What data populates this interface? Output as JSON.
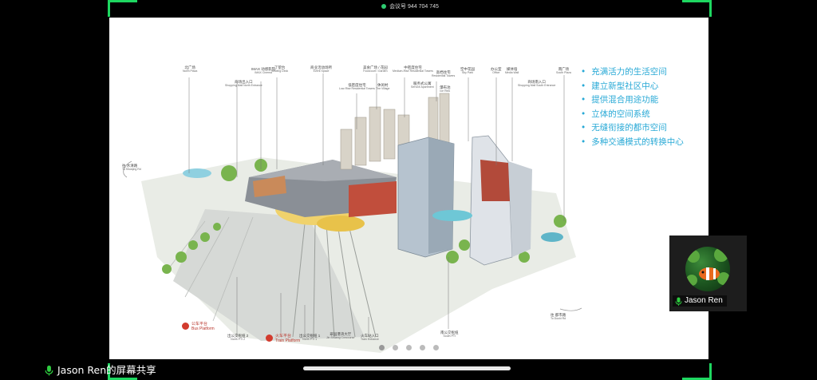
{
  "meeting": {
    "id_label": "会议号 944 704 745"
  },
  "slide": {
    "bullets": [
      "充满活力的生活空间",
      "建立新型社区中心",
      "提供混合用途功能",
      "立体的空间系统",
      "无缝衔接的都市空间",
      "多种交通模式的转换中心"
    ],
    "top_labels": [
      {
        "cn": "北广场",
        "en": "North Plaza"
      },
      {
        "cn": "商场出入口",
        "en": "Shopping Mall North Entrance"
      },
      {
        "cn": "IMAX 动感影院",
        "en": "IMAX Cinema"
      },
      {
        "cn": "了望台",
        "en": "Viewing Deck"
      },
      {
        "cn": "商业活动场所",
        "en": "Event Space"
      },
      {
        "cn": "低密度住宅",
        "en": "Low-Rise Residential Towers"
      },
      {
        "cn": "美食广场 / 花园",
        "en": "Foodcourt / Garden"
      },
      {
        "cn": "休闲村",
        "en": "The Village"
      },
      {
        "cn": "中密度住宅",
        "en": "Medium-Rise Residential Towers"
      },
      {
        "cn": "服务式公寓",
        "en": "Service Apartment"
      },
      {
        "cn": "高档住宅",
        "en": "Residential Towers"
      },
      {
        "cn": "瀑布池",
        "en": "Ice Rink"
      },
      {
        "cn": "空中花园",
        "en": "Sky Park"
      },
      {
        "cn": "办公室",
        "en": "Office"
      },
      {
        "cn": "媒体墙",
        "en": "Media Wall"
      },
      {
        "cn": "商场南入口",
        "en": "Shopping Mall South Entrance"
      },
      {
        "cn": "南广场",
        "en": "South Plaza"
      }
    ],
    "side_labels": {
      "left": {
        "cn": "往 水清路",
        "en": "To Shuiqing Rd"
      },
      "right": {
        "cn": "往 都市路",
        "en": "To Dushi Rd"
      }
    },
    "bottom_labels": [
      {
        "cn": "出公交枢纽 2",
        "en": "North PTI 2"
      },
      {
        "cn": "出公交枢纽 1",
        "en": "North PTI 1"
      },
      {
        "cn": "翠园港湾大厅",
        "en": "Jin Shuang Concourse"
      },
      {
        "cn": "火车站入口",
        "en": "Train Entrance"
      },
      {
        "cn": "南公交枢纽",
        "en": "South PTI"
      }
    ],
    "platforms": {
      "bus": {
        "cn": "公车平台",
        "en": "Bus Platform"
      },
      "train": {
        "cn": "火车平台",
        "en": "Train Platform"
      }
    },
    "pager": {
      "total": 5,
      "active": 1
    }
  },
  "participant": {
    "name": "Jason Ren"
  },
  "share_label": "Jason Ren的屏幕共享",
  "colors": {
    "accent_green": "#1ed760",
    "bullet_blue": "#28a9d6",
    "badge_red": "#d23b2e"
  }
}
